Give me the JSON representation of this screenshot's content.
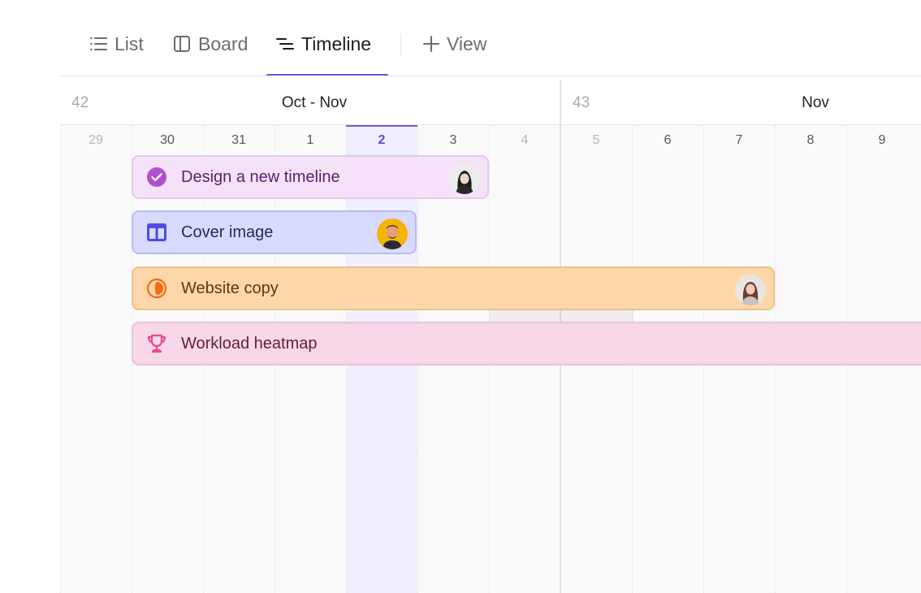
{
  "tabs": {
    "list": "List",
    "board": "Board",
    "timeline": "Timeline",
    "add_view": "View"
  },
  "timeline": {
    "weeks": [
      {
        "number": "42",
        "month": "Oct - Nov"
      },
      {
        "number": "43",
        "month": "Nov"
      }
    ],
    "days": [
      "29",
      "30",
      "31",
      "1",
      "2",
      "3",
      "4",
      "5",
      "6",
      "7",
      "8",
      "9"
    ],
    "today": "2"
  },
  "tasks": [
    {
      "title": "Design a new timeline",
      "icon": "check-circle-icon",
      "color": "#b04fcf"
    },
    {
      "title": "Cover image",
      "icon": "layout-icon",
      "color": "#4d4ce0"
    },
    {
      "title": "Website copy",
      "icon": "half-circle-icon",
      "color": "#f36a12"
    },
    {
      "title": "Workload heatmap",
      "icon": "trophy-icon",
      "color": "#e8488f"
    }
  ],
  "colors": {
    "accent": "#6a5ae0",
    "today_column": "#f1efff"
  }
}
